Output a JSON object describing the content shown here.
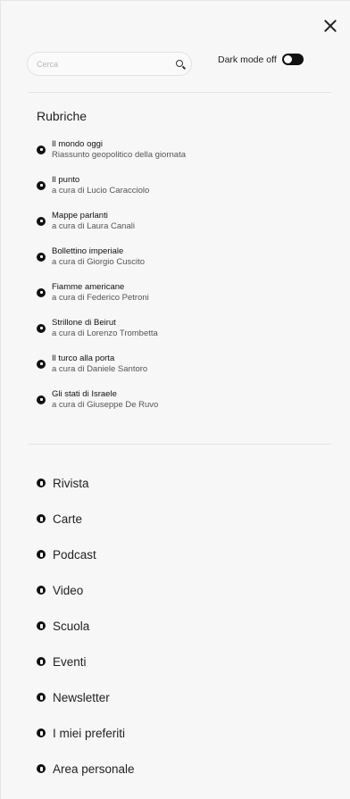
{
  "search": {
    "placeholder": "Cerca",
    "icon": "search-icon"
  },
  "dark_mode": {
    "label": "Dark mode off",
    "state": "off"
  },
  "rubriche": {
    "title": "Rubriche",
    "items": [
      {
        "title": "Il mondo oggi",
        "subtitle": "Riassunto geopolitico della giornata"
      },
      {
        "title": "Il punto",
        "subtitle": "a cura di Lucio Caracciolo"
      },
      {
        "title": "Mappe parlanti",
        "subtitle": "a cura di Laura Canali"
      },
      {
        "title": "Bollettino imperiale",
        "subtitle": "a cura di Giorgio Cuscito"
      },
      {
        "title": "Fiamme americane",
        "subtitle": "a cura di Federico Petroni"
      },
      {
        "title": "Strillone di Beirut",
        "subtitle": "a cura di Lorenzo Trombetta"
      },
      {
        "title": "Il turco alla porta",
        "subtitle": "a cura di Daniele Santoro"
      },
      {
        "title": "Gli stati di Israele",
        "subtitle": "a cura di Giuseppe De Ruvo"
      }
    ]
  },
  "nav": {
    "items": [
      {
        "label": "Rivista",
        "icon": "rivista-icon"
      },
      {
        "label": "Carte",
        "icon": "carte-icon"
      },
      {
        "label": "Podcast",
        "icon": "podcast-icon"
      },
      {
        "label": "Video",
        "icon": "video-icon"
      },
      {
        "label": "Scuola",
        "icon": "scuola-icon"
      },
      {
        "label": "Eventi",
        "icon": "eventi-icon"
      },
      {
        "label": "Newsletter",
        "icon": "newsletter-icon"
      },
      {
        "label": "I miei preferiti",
        "icon": "preferiti-icon"
      },
      {
        "label": "Area personale",
        "icon": "area-personale-icon"
      }
    ]
  }
}
